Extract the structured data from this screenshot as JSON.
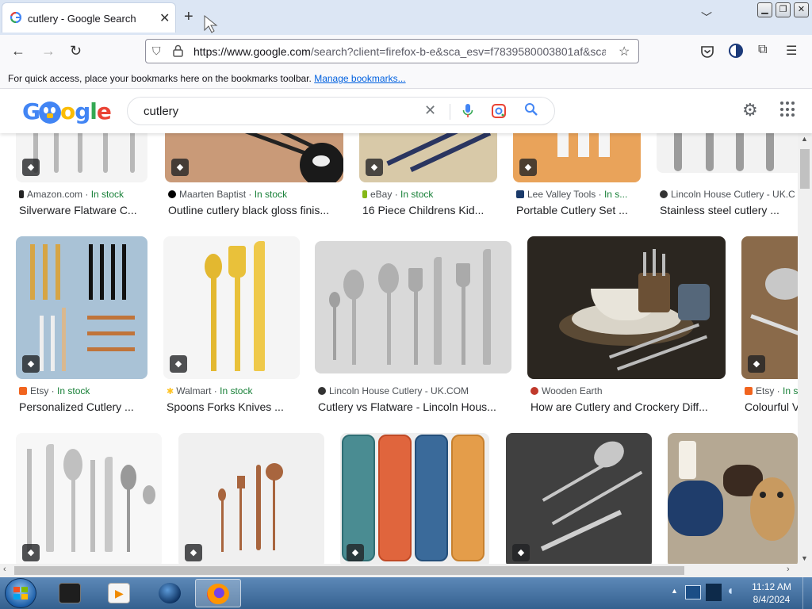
{
  "browser": {
    "tab_title": "cutlery - Google Search",
    "tab_close": "✕",
    "new_tab": "+",
    "url_host": "https://www.google.com",
    "url_rest": "/search?client=firefox-b-e&sca_esv=f7839580003801af&sca_",
    "bookmarks_msg": "For quick access, place your bookmarks here on the bookmarks toolbar.",
    "bookmarks_link": "Manage bookmarks..."
  },
  "google": {
    "logo": "Google",
    "query": "cutlery"
  },
  "row1": [
    {
      "site": "Amazon.com",
      "stock": "In stock",
      "caption": "Silverware Flatware C..."
    },
    {
      "site": "Maarten Baptist",
      "stock": "In stock",
      "caption": "Outline cutlery black gloss finis..."
    },
    {
      "site": "eBay",
      "stock": "In stock",
      "caption": "16 Piece Childrens Kid..."
    },
    {
      "site": "Lee Valley Tools",
      "stock": "In s...",
      "caption": "Portable Cutlery Set ..."
    },
    {
      "site": "Lincoln House Cutlery - UK.C",
      "stock": "",
      "caption": "Stainless steel cutlery ..."
    }
  ],
  "row2": [
    {
      "site": "Etsy",
      "stock": "In stock",
      "caption": "Personalized Cutlery ..."
    },
    {
      "site": "Walmart",
      "stock": "In stock",
      "caption": "Spoons Forks Knives ..."
    },
    {
      "site": "Lincoln House Cutlery - UK.COM",
      "stock": "",
      "caption": "Cutlery vs Flatware - Lincoln Hous..."
    },
    {
      "site": "Wooden Earth",
      "stock": "",
      "caption": "How are Cutlery and Crockery Diff..."
    },
    {
      "site": "Etsy",
      "stock": "In s",
      "caption": "Colourful V"
    }
  ],
  "taskbar": {
    "time": "11:12 AM",
    "date": "8/4/2024"
  },
  "colors": {
    "in_stock": "#188038",
    "tab_strip": "#dce6f4",
    "taskbar": "#34618f"
  }
}
